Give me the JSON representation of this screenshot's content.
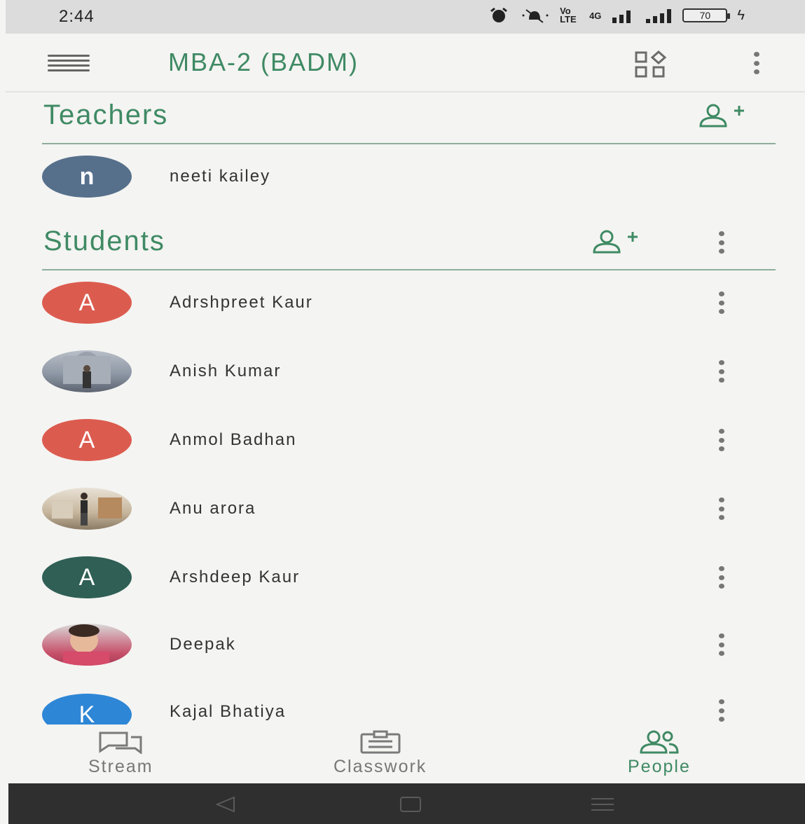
{
  "status_bar": {
    "time": "2:44",
    "network_label": "Vo LTE",
    "signal_label": "4G",
    "battery": "70"
  },
  "app_bar": {
    "title": "MBA-2 (BADM)"
  },
  "teachers": {
    "title": "Teachers",
    "items": [
      {
        "initial": "n",
        "name": "neeti kailey",
        "color": "#56708c"
      }
    ]
  },
  "students": {
    "title": "Students",
    "items": [
      {
        "initial": "A",
        "name": "Adrshpreet Kaur",
        "color": "#dc5b4f",
        "photo": false
      },
      {
        "initial": "",
        "name": "Anish Kumar",
        "color": "#8f98a6",
        "photo": true
      },
      {
        "initial": "A",
        "name": "Anmol Badhan",
        "color": "#dc5b4f",
        "photo": false
      },
      {
        "initial": "",
        "name": "Anu arora",
        "color": "#c6b59c",
        "photo": true
      },
      {
        "initial": "A",
        "name": "Arshdeep Kaur",
        "color": "#2f5f55",
        "photo": false
      },
      {
        "initial": "",
        "name": "Deepak",
        "color": "#c7506a",
        "photo": true
      },
      {
        "initial": "K",
        "name": "Kajal Bhatiya",
        "color": "#2e86d6",
        "photo": false
      }
    ]
  },
  "bottom_nav": {
    "stream": "Stream",
    "classwork": "Classwork",
    "people": "People"
  },
  "colors": {
    "accent": "#3f8a64",
    "text": "#333333",
    "muted": "#777777"
  }
}
